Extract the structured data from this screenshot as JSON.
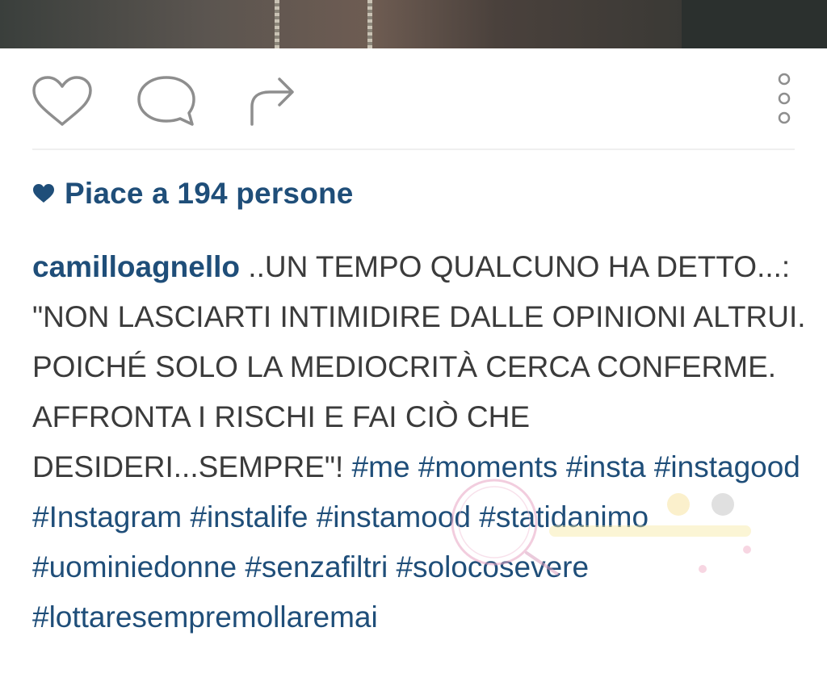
{
  "post": {
    "likes_text": "Piace a 194 persone",
    "username": "camilloagnello",
    "caption_text": " ..UN TEMPO QUALCUNO HA DETTO...: \"NON LASCIARTI INTIMIDIRE DALLE OPINIONI ALTRUI. POICHÉ SOLO LA MEDIOCRITÀ CERCA CONFERME. AFFRONTA I RISCHI E FAI CIÒ CHE DESIDERI...SEMPRE\"! ",
    "hashtags": [
      "#me",
      "#moments",
      "#insta",
      "#instagood",
      "#Instagram",
      "#instalife",
      "#instamood",
      "#statidanimo",
      "#uominiedonne",
      "#senzafiltri",
      "#solocosevere",
      "#lottaresempremollaremai"
    ]
  },
  "icons": {
    "like": "heart-outline-icon",
    "comment": "comment-bubble-icon",
    "share": "share-arrow-icon",
    "more": "vertical-dots-icon",
    "likes_heart": "heart-filled-icon"
  },
  "colors": {
    "link_blue": "#1f4e79",
    "text_gray": "#3b3b3b",
    "icon_gray": "#8e8e8e"
  }
}
